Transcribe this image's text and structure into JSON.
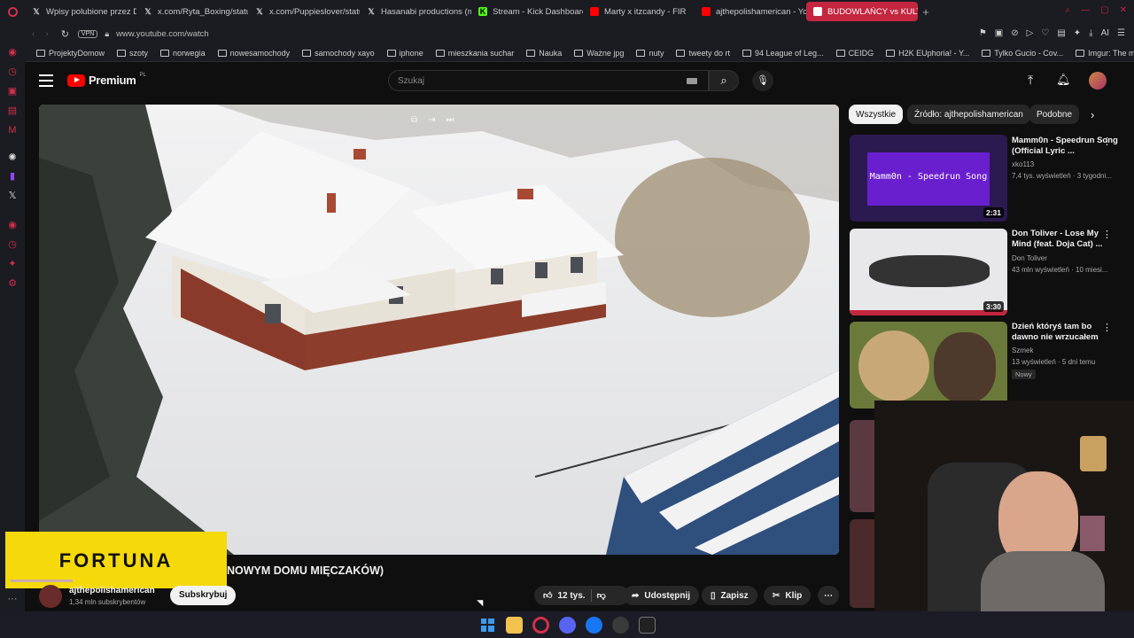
{
  "tabs": [
    {
      "label": "Wpisy polubione przez Do",
      "icon": "x-icon"
    },
    {
      "label": "x.com/Ryta_Boxing/status",
      "icon": "x-icon"
    },
    {
      "label": "x.com/Puppieslover/statu",
      "icon": "x-icon"
    },
    {
      "label": "Hasanabi productions (me",
      "icon": "x-icon"
    },
    {
      "label": "Stream - Kick Dashboard",
      "icon": "kick-icon"
    },
    {
      "label": "Marty x itzcandy - FIR",
      "icon": "youtube-icon"
    },
    {
      "label": "ajthepolishamerican - You",
      "icon": "youtube-icon"
    },
    {
      "label": "BUDOWLAŃCY vs KULTU",
      "icon": "youtube-icon"
    }
  ],
  "address": {
    "vpn": "VPN",
    "url": "www.youtube.com/watch"
  },
  "bookmarks": [
    "ProjektyDomow",
    "szoty",
    "norwegia",
    "nowesamochody",
    "samochody xayo",
    "iphone",
    "mieszkania suchar",
    "Nauka",
    "Ważne jpg",
    "nuty",
    "tweety do rt",
    "94 League of Leg...",
    "CEIDG",
    "H2K EUphoria! - Y...",
    "Tylko Gucio - Cov...",
    "Imgur: The most a..."
  ],
  "yt": {
    "logo": "Premium",
    "logo_sup": "PL",
    "search_placeholder": "Szukaj",
    "chips": [
      "Wszystkie",
      "Źródło: ajthepolishamerican",
      "Podobne"
    ],
    "video_title": "NOWYM DOMU MIĘCZAKÓW)",
    "channel": "ajthepolishamerican",
    "subscribers": "1,34 mln subskrybentów",
    "subscribe": "Subskrybuj",
    "likes": "12 tys.",
    "share": "Udostępnij",
    "save": "Zapisz",
    "clip": "Klip",
    "sponsor": "FORTUNA"
  },
  "recommended": [
    {
      "title": "Mamm0n - Speedrun Song (Official Lyric ...",
      "channel": "xko113",
      "meta": "7,4 tys. wyświetleń · 3 tygodni...",
      "duration": "2:31",
      "thumb_text": "Mamm0n - Speedrun Song"
    },
    {
      "title": "Don Toliver - Lose My Mind (feat. Doja Cat) ...",
      "channel": "Don Toliver",
      "meta": "43 mln wyświetleń · 10 miesi...",
      "duration": "3:30"
    },
    {
      "title": "Dzień któryś tam bo dawno nie wrzucałem",
      "channel": "Szmek",
      "meta": "13 wyświetleń · 5 dni temu",
      "badge": "Nowy"
    }
  ],
  "colors": {
    "accent": "#c4263f",
    "yt_red": "#ff0000",
    "fortuna": "#f5d90a"
  }
}
